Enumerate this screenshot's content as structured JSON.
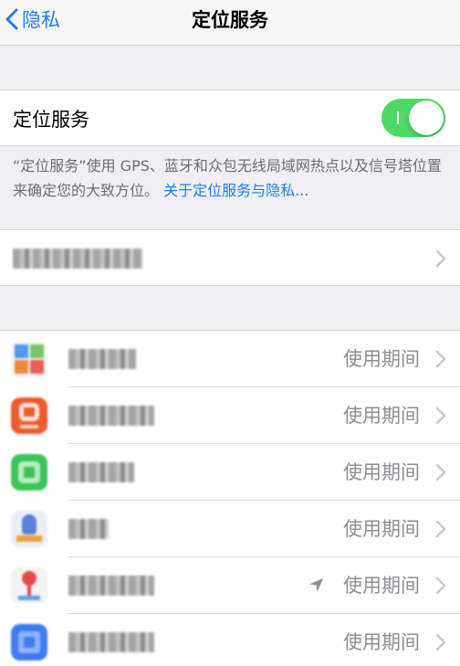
{
  "navbar": {
    "back_label": "隐私",
    "title": "定位服务"
  },
  "location_services": {
    "label": "定位服务",
    "toggle_on": true,
    "toggle_color": "#4cd964"
  },
  "footer": {
    "text": "“定位服务”使用 GPS、蓝牙和众包无线局域网热点以及信号塔位置来确定您的大致方位。",
    "link": "关于定位服务与隐私..."
  },
  "apps": [
    {
      "icon": "multicolor-blocks-app-icon",
      "status": "使用期间",
      "show_arrow": false
    },
    {
      "icon": "orange-app-icon",
      "status": "使用期间",
      "show_arrow": false
    },
    {
      "icon": "green-app-icon",
      "status": "使用期间",
      "show_arrow": false
    },
    {
      "icon": "blue-character-app-icon",
      "status": "使用期间",
      "show_arrow": false
    },
    {
      "icon": "map-pin-app-icon",
      "status": "使用期间",
      "show_arrow": true
    },
    {
      "icon": "blue-square-app-icon",
      "status": "使用期间",
      "show_arrow": false
    }
  ],
  "colors": {
    "accent": "#1f7cf5",
    "background": "#efeff4",
    "secondary_text": "#8e8e93"
  }
}
